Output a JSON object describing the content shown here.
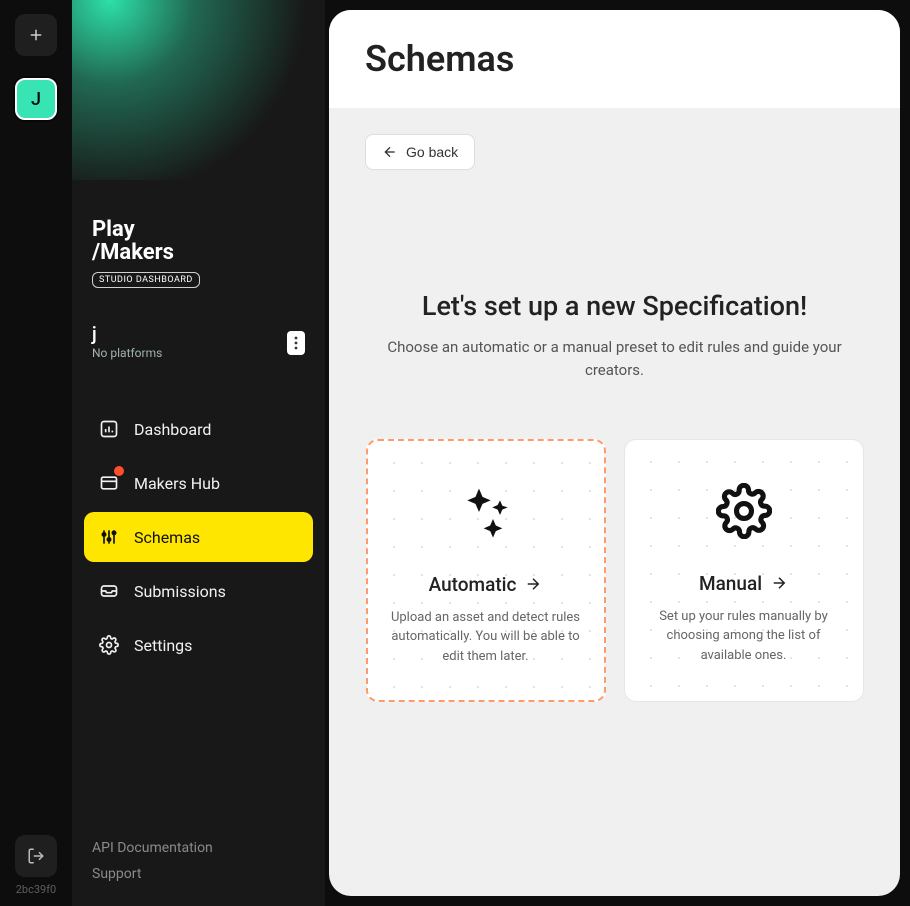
{
  "rail": {
    "avatar_letter": "J",
    "version": "2bc39f0"
  },
  "brand": {
    "line1": "Play",
    "line2": "/Makers",
    "badge": "STUDIO DASHBOARD"
  },
  "workspace": {
    "name": "j",
    "sub": "No platforms"
  },
  "nav": {
    "dashboard": "Dashboard",
    "makers_hub": "Makers Hub",
    "schemas": "Schemas",
    "submissions": "Submissions",
    "settings": "Settings"
  },
  "footer": {
    "api_docs": "API Documentation",
    "support": "Support"
  },
  "page": {
    "title": "Schemas",
    "back": "Go back",
    "setup_title": "Let's set up a new Specification!",
    "setup_sub": "Choose an automatic or a manual preset to edit rules and guide your creators."
  },
  "cards": {
    "automatic": {
      "title": "Automatic",
      "desc": "Upload an asset and detect rules automatically. You will be able to edit them later."
    },
    "manual": {
      "title": "Manual",
      "desc": "Set up your rules manually by choosing among the list of available ones."
    }
  }
}
